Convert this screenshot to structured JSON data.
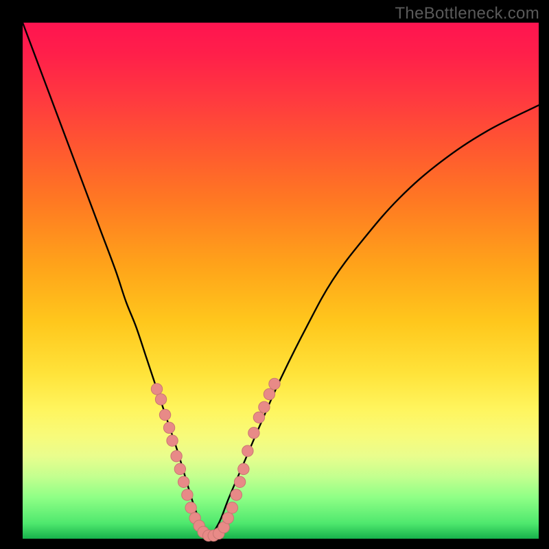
{
  "watermark": "TheBottleneck.com",
  "colors": {
    "curve": "#000000",
    "marker_fill": "#e88a87",
    "marker_stroke": "#c87672"
  },
  "chart_data": {
    "type": "line",
    "title": "",
    "xlabel": "",
    "ylabel": "",
    "xlim": [
      0,
      100
    ],
    "ylim": [
      0,
      100
    ],
    "grid": false,
    "series": [
      {
        "name": "bottleneck-curve",
        "x": [
          0,
          3,
          6,
          9,
          12,
          15,
          18,
          20,
          22,
          24,
          26,
          28,
          30,
          31.5,
          33,
          34.5,
          36,
          38,
          40,
          43,
          46,
          50,
          55,
          60,
          66,
          73,
          81,
          90,
          100
        ],
        "y": [
          100,
          92,
          84,
          76,
          68,
          60,
          52,
          46,
          41,
          35,
          29,
          23,
          17,
          12,
          7,
          3,
          0.5,
          3,
          8,
          15,
          22,
          31,
          41,
          50,
          58,
          66,
          73,
          79,
          84
        ]
      }
    ],
    "markers": {
      "name": "highlight-dots",
      "points": [
        {
          "x": 26.0,
          "y": 29.0
        },
        {
          "x": 26.8,
          "y": 27.0
        },
        {
          "x": 27.6,
          "y": 24.0
        },
        {
          "x": 28.4,
          "y": 21.5
        },
        {
          "x": 29.0,
          "y": 19.0
        },
        {
          "x": 29.8,
          "y": 16.0
        },
        {
          "x": 30.5,
          "y": 13.5
        },
        {
          "x": 31.2,
          "y": 11.0
        },
        {
          "x": 31.9,
          "y": 8.5
        },
        {
          "x": 32.6,
          "y": 6.0
        },
        {
          "x": 33.4,
          "y": 4.0
        },
        {
          "x": 34.2,
          "y": 2.5
        },
        {
          "x": 35.0,
          "y": 1.3
        },
        {
          "x": 36.0,
          "y": 0.6
        },
        {
          "x": 37.0,
          "y": 0.6
        },
        {
          "x": 38.0,
          "y": 1.0
        },
        {
          "x": 39.0,
          "y": 2.2
        },
        {
          "x": 39.8,
          "y": 4.0
        },
        {
          "x": 40.6,
          "y": 6.0
        },
        {
          "x": 41.4,
          "y": 8.5
        },
        {
          "x": 42.1,
          "y": 11.0
        },
        {
          "x": 42.8,
          "y": 13.5
        },
        {
          "x": 43.6,
          "y": 17.0
        },
        {
          "x": 44.8,
          "y": 20.5
        },
        {
          "x": 45.8,
          "y": 23.5
        },
        {
          "x": 46.8,
          "y": 25.5
        },
        {
          "x": 47.8,
          "y": 28.0
        },
        {
          "x": 48.8,
          "y": 30.0
        }
      ]
    }
  }
}
